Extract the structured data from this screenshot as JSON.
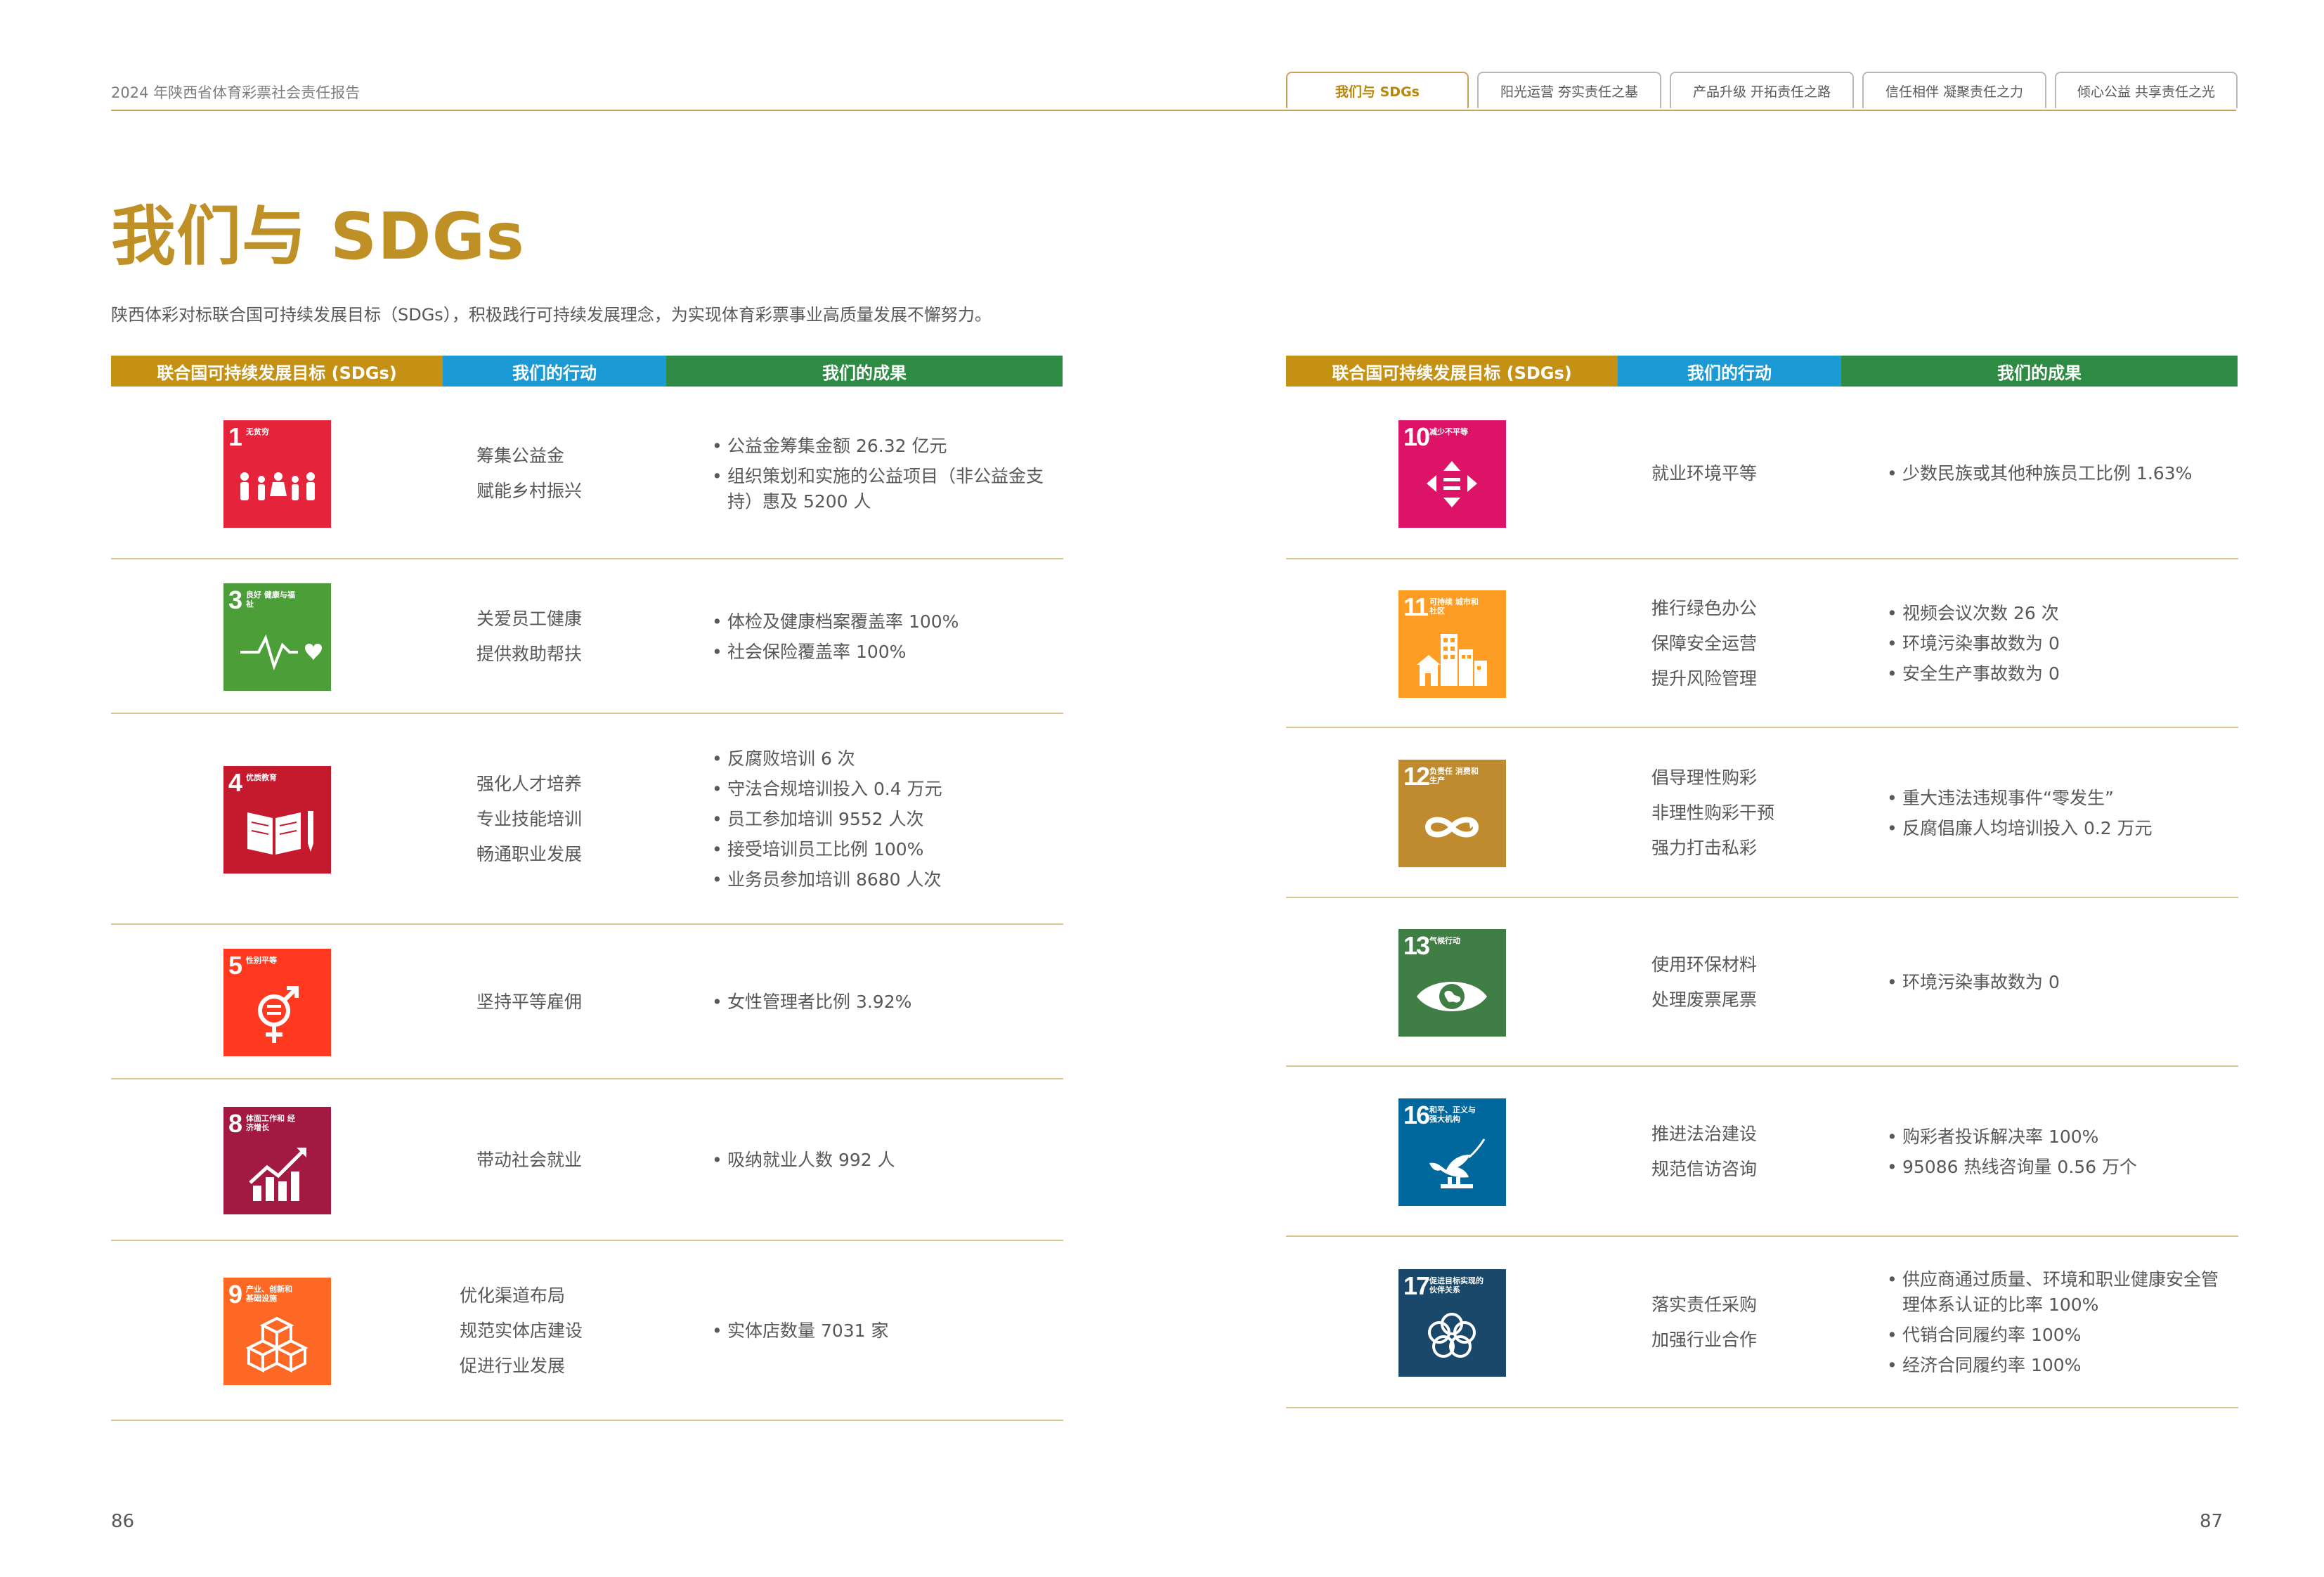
{
  "header": {
    "report_title": "2024 年陕西省体育彩票社会责任报告",
    "tabs": [
      "我们与 SDGs",
      "阳光运营  夯实责任之基",
      "产品升级  开拓责任之路",
      "信任相伴  凝聚责任之力",
      "倾心公益  共享责任之光"
    ]
  },
  "page": {
    "heading": "我们与 SDGs",
    "intro": "陕西体彩对标联合国可持续发展目标（SDGs），积极践行可持续发展理念，为实现体育彩票事业高质量发展不懈努力。"
  },
  "table_headers": {
    "sdg": "联合国可持续发展目标 (SDGs)",
    "actions": "我们的行动",
    "results": "我们的成果"
  },
  "left_rows": [
    {
      "goal": {
        "number": "1",
        "name": "无贫穷",
        "color": "#e5243b",
        "icon": "family-icon"
      },
      "actions": [
        "筹集公益金",
        "赋能乡村振兴"
      ],
      "results": [
        "公益金筹集金额 26.32 亿元",
        "组织策划和实施的公益项目（非公益金支持）惠及 5200 人"
      ]
    },
    {
      "goal": {
        "number": "3",
        "name": "良好 健康与福祉",
        "color": "#4c9f38",
        "icon": "heartbeat-icon"
      },
      "actions": [
        "关爱员工健康",
        "提供救助帮扶"
      ],
      "results": [
        "体检及健康档案覆盖率 100%",
        "社会保险覆盖率 100%"
      ]
    },
    {
      "goal": {
        "number": "4",
        "name": "优质教育",
        "color": "#c5192d",
        "icon": "book-icon"
      },
      "actions": [
        "强化人才培养",
        "专业技能培训",
        "畅通职业发展"
      ],
      "results": [
        "反腐败培训 6 次",
        "守法合规培训投入 0.4 万元",
        "员工参加培训 9552 人次",
        "接受培训员工比例 100%",
        "业务员参加培训 8680 人次"
      ]
    },
    {
      "goal": {
        "number": "5",
        "name": "性别平等",
        "color": "#ff3a21",
        "icon": "gender-icon"
      },
      "actions": [
        "坚持平等雇佣"
      ],
      "results": [
        "女性管理者比例 3.92%"
      ]
    },
    {
      "goal": {
        "number": "8",
        "name": "体面工作和 经济增长",
        "color": "#a21942",
        "icon": "growth-chart-icon"
      },
      "actions": [
        "带动社会就业"
      ],
      "results": [
        "吸纳就业人数 992 人"
      ]
    },
    {
      "goal": {
        "number": "9",
        "name": "产业、创新和 基础设施",
        "color": "#fd6925",
        "icon": "cubes-icon"
      },
      "actions": [
        "优化渠道布局",
        "规范实体店建设",
        "促进行业发展"
      ],
      "results": [
        "实体店数量 7031 家"
      ]
    }
  ],
  "right_rows": [
    {
      "goal": {
        "number": "10",
        "name": "减少不平等",
        "color": "#dd1367",
        "icon": "equality-arrows-icon"
      },
      "actions": [
        "就业环境平等"
      ],
      "results": [
        "少数民族或其他种族员工比例 1.63%"
      ]
    },
    {
      "goal": {
        "number": "11",
        "name": "可持续 城市和社区",
        "color": "#fd9d24",
        "icon": "city-icon"
      },
      "actions": [
        "推行绿色办公",
        "保障安全运营",
        "提升风险管理"
      ],
      "results": [
        "视频会议次数 26 次",
        "环境污染事故数为 0",
        "安全生产事故数为 0"
      ]
    },
    {
      "goal": {
        "number": "12",
        "name": "负责任 消费和生产",
        "color": "#bf8b2e",
        "icon": "infinity-icon"
      },
      "actions": [
        "倡导理性购彩",
        "非理性购彩干预",
        "强力打击私彩"
      ],
      "results": [
        "重大违法违规事件“零发生”",
        "反腐倡廉人均培训投入 0.2 万元"
      ]
    },
    {
      "goal": {
        "number": "13",
        "name": "气候行动",
        "color": "#3f7e44",
        "icon": "earth-eye-icon"
      },
      "actions": [
        "使用环保材料",
        "处理废票尾票"
      ],
      "results": [
        "环境污染事故数为 0"
      ]
    },
    {
      "goal": {
        "number": "16",
        "name": "和平、正义与 强大机构",
        "color": "#00689d",
        "icon": "dove-icon"
      },
      "actions": [
        "推进法治建设",
        "规范信访咨询"
      ],
      "results": [
        "购彩者投诉解决率 100%",
        "95086 热线咨询量 0.56 万个"
      ]
    },
    {
      "goal": {
        "number": "17",
        "name": "促进目标实现的 伙伴关系",
        "color": "#19486a",
        "icon": "partnership-rings-icon"
      },
      "actions": [
        "落实责任采购",
        "加强行业合作"
      ],
      "results": [
        "供应商通过质量、环境和职业健康安全管理体系认证的比率 100%",
        "代销合同履约率 100%",
        "经济合同履约率 100%"
      ]
    }
  ],
  "page_numbers": {
    "left": "86",
    "right": "87"
  }
}
